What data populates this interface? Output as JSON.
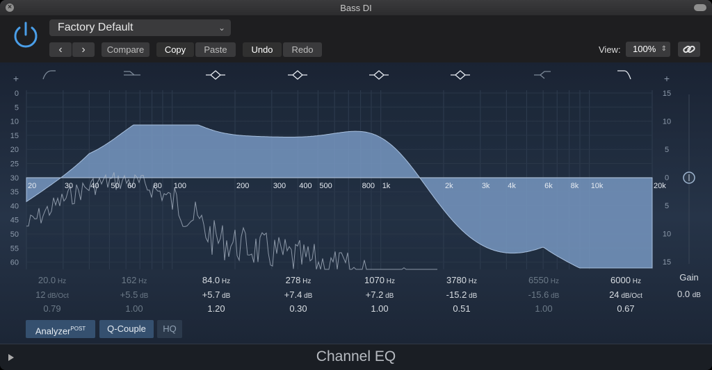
{
  "window": {
    "title": "Bass DI"
  },
  "header": {
    "preset": "Factory Default",
    "compare_label": "Compare",
    "copy_label": "Copy",
    "paste_label": "Paste",
    "undo_label": "Undo",
    "redo_label": "Redo",
    "view_label": "View:",
    "view_value": "100%"
  },
  "display": {
    "left_scale": [
      "+",
      "0",
      "5",
      "10",
      "15",
      "20",
      "25",
      "30",
      "35",
      "40",
      "45",
      "50",
      "55",
      "60"
    ],
    "right_scale": [
      "+",
      "15",
      "10",
      "5",
      "0",
      "5",
      "10",
      "15"
    ],
    "freq_labels": [
      "20",
      "30",
      "40",
      "50",
      "60",
      "80",
      "100",
      "200",
      "300",
      "400",
      "500",
      "800",
      "1k",
      "2k",
      "3k",
      "4k",
      "6k",
      "8k",
      "10k",
      "20k"
    ]
  },
  "bands": [
    {
      "freq": "20.0",
      "freq_unit": "Hz",
      "gain": "12",
      "gain_unit": "dB/Oct",
      "q": "0.79",
      "active": false,
      "icon": "low-cut-icon"
    },
    {
      "freq": "162",
      "freq_unit": "Hz",
      "gain": "+5.5",
      "gain_unit": "dB",
      "q": "1.00",
      "active": false,
      "icon": "low-shelf-icon"
    },
    {
      "freq": "84.0",
      "freq_unit": "Hz",
      "gain": "+5.7",
      "gain_unit": "dB",
      "q": "1.20",
      "active": true,
      "icon": "bell-icon"
    },
    {
      "freq": "278",
      "freq_unit": "Hz",
      "gain": "+7.4",
      "gain_unit": "dB",
      "q": "0.30",
      "active": true,
      "icon": "bell-icon"
    },
    {
      "freq": "1070",
      "freq_unit": "Hz",
      "gain": "+7.2",
      "gain_unit": "dB",
      "q": "1.00",
      "active": true,
      "icon": "bell-icon"
    },
    {
      "freq": "3780",
      "freq_unit": "Hz",
      "gain": "-15.2",
      "gain_unit": "dB",
      "q": "0.51",
      "active": true,
      "icon": "bell-icon"
    },
    {
      "freq": "6550",
      "freq_unit": "Hz",
      "gain": "-15.6",
      "gain_unit": "dB",
      "q": "1.00",
      "active": false,
      "icon": "high-shelf-icon"
    },
    {
      "freq": "6000",
      "freq_unit": "Hz",
      "gain": "24",
      "gain_unit": "dB/Oct",
      "q": "0.67",
      "active": true,
      "icon": "high-cut-icon"
    }
  ],
  "gain": {
    "label": "Gain",
    "value": "0.0",
    "unit": "dB"
  },
  "toggles": {
    "analyzer": "Analyzer",
    "analyzer_sup": "POST",
    "q_couple": "Q-Couple",
    "hq": "HQ"
  },
  "footer": {
    "title": "Channel EQ"
  },
  "colors": {
    "accent": "#7aa9e0",
    "curve_fill": "#7a9bc6",
    "background": "#1d2733"
  }
}
